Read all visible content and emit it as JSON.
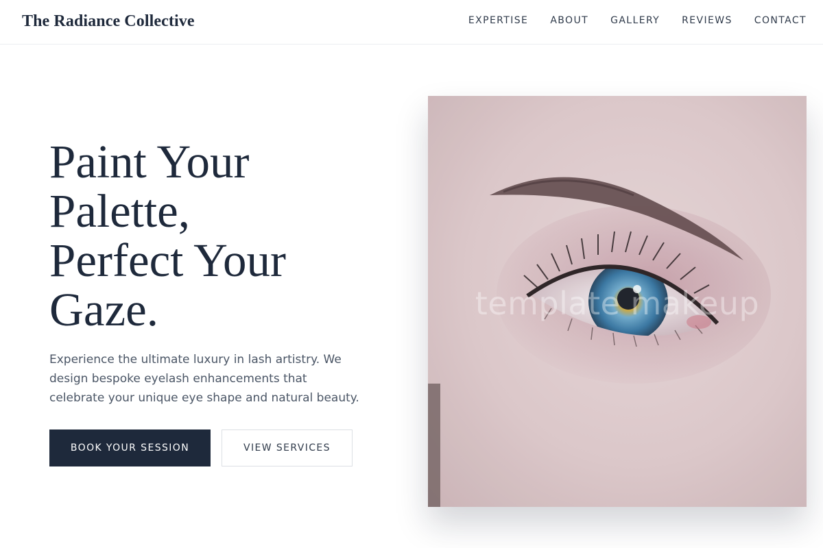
{
  "header": {
    "brand": "The Radiance Collective",
    "nav": [
      "EXPERTISE",
      "ABOUT",
      "GALLERY",
      "REVIEWS",
      "CONTACT"
    ]
  },
  "hero": {
    "title_lines": [
      "Paint Your",
      "Palette,",
      "Perfect Your",
      "Gaze."
    ],
    "description": "Experience the ultimate luxury in lash artistry. We design bespoke eyelash enhancements that celebrate your unique eye shape and natural beauty.",
    "primary_button": "BOOK YOUR SESSION",
    "secondary_button": "VIEW SERVICES"
  },
  "image": {
    "watermark": "template makeup",
    "subject": "close-up-blue-eye"
  },
  "colors": {
    "primary": "#1e293b",
    "text_muted": "#4a5565",
    "border": "#dcdfe4",
    "background": "#ffffff"
  }
}
